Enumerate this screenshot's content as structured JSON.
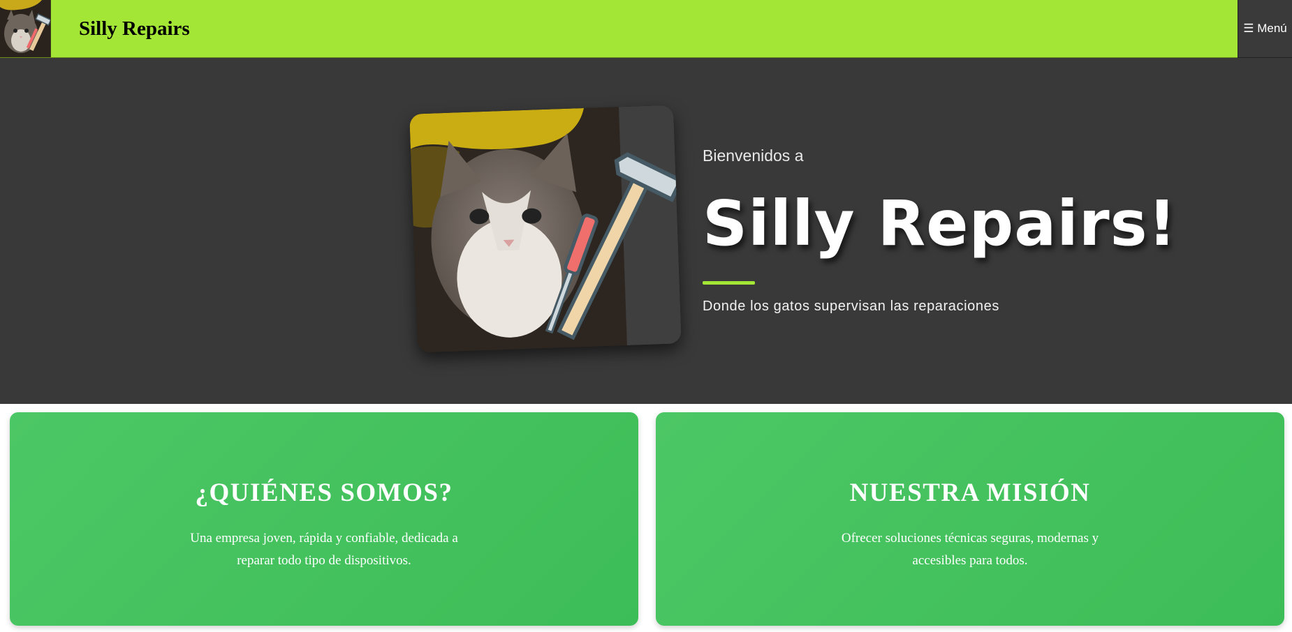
{
  "header": {
    "brand": "Silly Repairs",
    "menu_label": "☰ Menú",
    "logo_icon": "cat-with-tools-logo"
  },
  "hero": {
    "greeting": "Bienvenidos a",
    "title": "Silly Repairs!",
    "tagline": "Donde los gatos supervisan las reparaciones",
    "image_icon": "cat-with-hammer-and-screwdriver"
  },
  "cards": [
    {
      "title": "¿QUIÉNES SOMOS?",
      "text": "Una empresa joven, rápida y confiable, dedicada a reparar todo tipo de dispositivos."
    },
    {
      "title": "NUESTRA MISIÓN",
      "text": "Ofrecer soluciones técnicas seguras, modernas y accesibles para todos."
    }
  ],
  "colors": {
    "header_bg": "#a3e635",
    "hero_bg": "#393939",
    "card_bg": "#45c25f",
    "accent": "#a3e635"
  }
}
